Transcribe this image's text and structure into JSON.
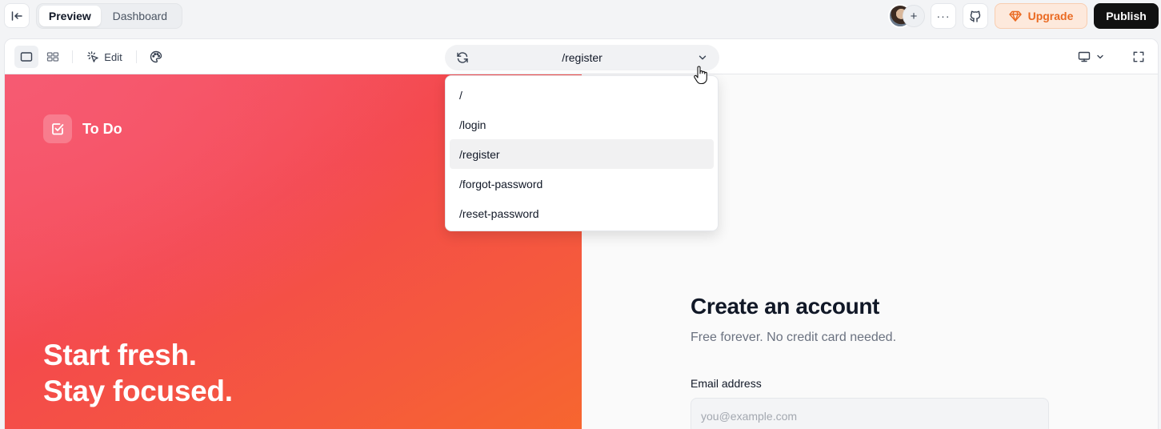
{
  "topbar": {
    "tabs": [
      {
        "label": "Preview",
        "active": true
      },
      {
        "label": "Dashboard",
        "active": false
      }
    ],
    "add_collaborator": "+",
    "more": "···",
    "upgrade_label": "Upgrade",
    "publish_label": "Publish"
  },
  "toolbar": {
    "edit_label": "Edit",
    "route": {
      "value": "/register",
      "options": [
        "/",
        "/login",
        "/register",
        "/forgot-password",
        "/reset-password"
      ],
      "selected_index": 2
    }
  },
  "page": {
    "logo_text": "To Do",
    "hero_line1": "Start fresh.",
    "hero_line2": "Stay focused.",
    "title": "Create an account",
    "subtitle": "Free forever. No credit card needed.",
    "email_label": "Email address",
    "email_placeholder": "you@example.com",
    "email_value": ""
  },
  "colors": {
    "accent_upgrade": "#ea6a22",
    "publish_bg": "#111111",
    "hero_gradient_start": "#f65568",
    "hero_gradient_end": "#f7672e"
  },
  "icons": [
    "collapse-sidebar-icon",
    "github-icon",
    "gem-icon",
    "single-view-icon",
    "grid-view-icon",
    "cursor-click-icon",
    "palette-icon",
    "refresh-icon",
    "chevron-down-icon",
    "monitor-icon",
    "fullscreen-icon",
    "checkbox-icon",
    "hand-pointer-icon"
  ]
}
